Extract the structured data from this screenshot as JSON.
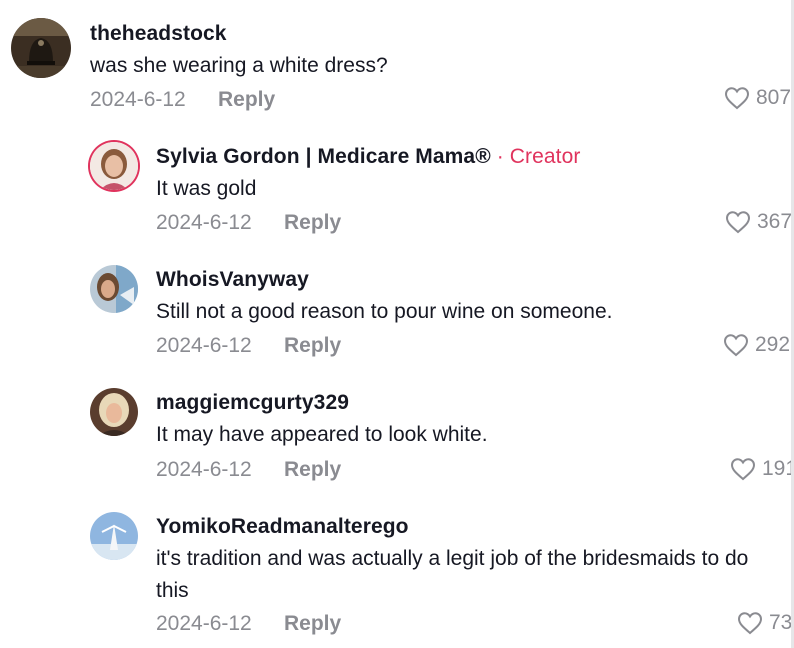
{
  "comments": [
    {
      "username": "theheadstock",
      "text": "was she wearing a white dress?",
      "date": "2024-6-12",
      "reply_label": "Reply",
      "likes": "807",
      "avatar": "bell-photo"
    },
    {
      "username": "Sylvia Gordon | Medicare Mama®",
      "badge_sep": "·",
      "badge": "Creator",
      "text": "It was gold",
      "date": "2024-6-12",
      "reply_label": "Reply",
      "likes": "367",
      "avatar": "woman-portrait"
    },
    {
      "username": "WhoisVanyway",
      "text": "Still not a good reason to pour wine on someone.",
      "date": "2024-6-12",
      "reply_label": "Reply",
      "likes": "292",
      "avatar": "woman-selfie"
    },
    {
      "username": "maggiemcgurty329",
      "text": "It may have appeared to look white.",
      "date": "2024-6-12",
      "reply_label": "Reply",
      "likes": "191",
      "avatar": "blonde-woman"
    },
    {
      "username": "YomikoReadmanalterego",
      "text_line1": "it's tradition and was actually a legit job of the bridesmaids to do",
      "text_line2": "this",
      "date": "2024-6-12",
      "reply_label": "Reply",
      "likes": "73",
      "avatar": "sky-figure"
    }
  ],
  "colors": {
    "text": "#161823",
    "muted": "#8a8b91",
    "creator_accent": "#e0335d"
  },
  "icons": {
    "like": "heart-outline-icon"
  }
}
